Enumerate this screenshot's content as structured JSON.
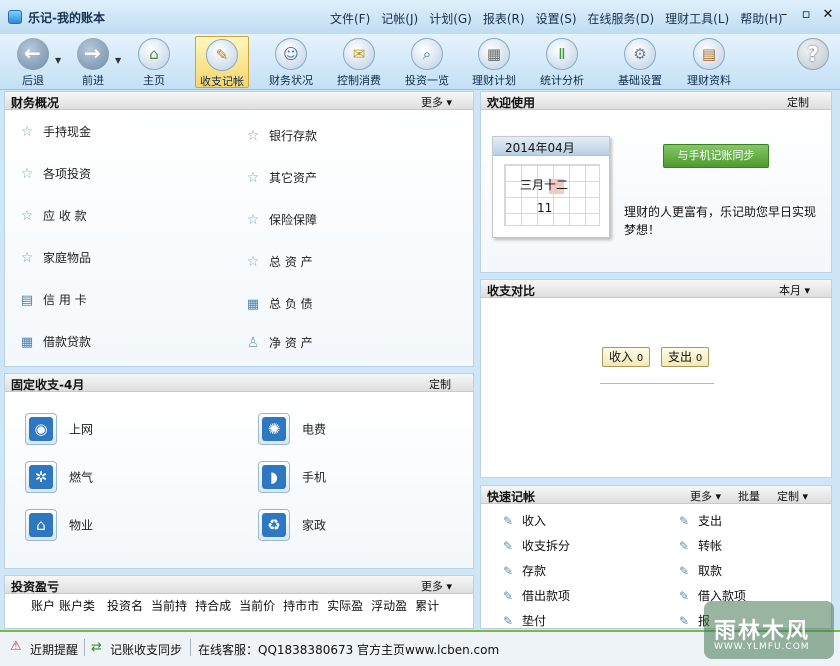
{
  "window": {
    "title": "乐记-我的账本",
    "controls": [
      "–",
      "▫",
      "✕"
    ]
  },
  "menu": [
    "文件(F)",
    "记帐(J)",
    "计划(G)",
    "报表(R)",
    "设置(S)",
    "在线服务(D)",
    "理财工具(L)",
    "帮助(H)"
  ],
  "toolbar": {
    "buttons": [
      {
        "label": "后退",
        "icon": "back-icon"
      },
      {
        "label": "前进",
        "icon": "forward-icon"
      },
      {
        "label": "主页",
        "icon": "home-icon"
      },
      {
        "label": "收支记帐",
        "icon": "pen-icon",
        "active": true
      },
      {
        "label": "财务状况",
        "icon": "person-icon"
      },
      {
        "label": "控制消费",
        "icon": "envelope-icon"
      },
      {
        "label": "投资一览",
        "icon": "magnifier-icon"
      },
      {
        "label": "理财计划",
        "icon": "calendar-icon"
      },
      {
        "label": "统计分析",
        "icon": "bar-chart-icon"
      },
      {
        "label": "基础设置",
        "icon": "gear-icon"
      },
      {
        "label": "理财资料",
        "icon": "book-icon"
      },
      {
        "label": "",
        "icon": "help-icon"
      }
    ]
  },
  "finance": {
    "title": "财务概况",
    "more": "更多",
    "left": [
      "手持现金",
      "各项投资",
      "应 收 款",
      "家庭物品",
      "信 用 卡",
      "借款贷款"
    ],
    "right": [
      "银行存款",
      "其它资产",
      "保险保障",
      "总 资 产",
      "总 负 债",
      "净 资 产"
    ]
  },
  "fixed": {
    "title": "固定收支-4月",
    "custom": "定制",
    "left": [
      "上网",
      "燃气",
      "物业"
    ],
    "right": [
      "电费",
      "手机",
      "家政"
    ]
  },
  "investment": {
    "title": "投资盈亏",
    "more": "更多",
    "columns": [
      "账户",
      "账户类",
      "投资名",
      "当前持",
      "持合成",
      "当前价",
      "持市市",
      "实际盈",
      "浮动盈",
      "累计"
    ]
  },
  "welcome": {
    "title": "欢迎使用",
    "custom": "定制",
    "calendar_month": "2014年04月",
    "lunar_date": "三月十二",
    "day": "11",
    "sync_button": "与手机记账同步",
    "slogan": "理财的人更富有，乐记助您早日实现梦想！"
  },
  "comparison": {
    "title": "收支对比",
    "period": "本月",
    "income_label": "收入",
    "income_value": "0",
    "expense_label": "支出",
    "expense_value": "0"
  },
  "quick": {
    "title": "快速记帐",
    "more": "更多",
    "batch": "批量",
    "custom": "定制",
    "left": [
      "收入",
      "收支拆分",
      "存款",
      "借出款项",
      "垫付"
    ],
    "right": [
      "支出",
      "转帐",
      "取款",
      "借入款项",
      "报"
    ]
  },
  "status": {
    "reminder": "近期提醒",
    "sync": "记账收支同步",
    "service": "在线客服：QQ1838380673",
    "homepage": "官方主页www.lcben.com"
  },
  "watermark": {
    "name": "雨林木风",
    "url": "WWW.YLMFU.COM"
  },
  "colors": {
    "statusbar_border": "#7bb846",
    "sync_button": "#5aa83c",
    "active_tab": "#f8d56a",
    "warning": "#d43a2a"
  }
}
